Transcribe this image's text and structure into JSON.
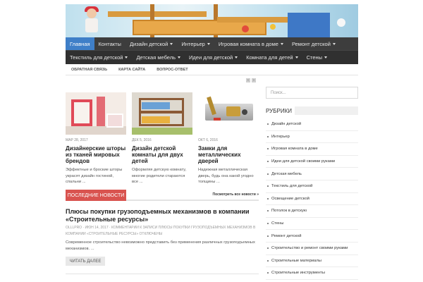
{
  "nav_primary": [
    {
      "label": "Главная",
      "dropdown": false,
      "active": true
    },
    {
      "label": "Контакты",
      "dropdown": false,
      "active": false
    },
    {
      "label": "Дизайн детской",
      "dropdown": true,
      "active": false
    },
    {
      "label": "Интерьер",
      "dropdown": true,
      "active": false
    },
    {
      "label": "Игровая комната в доме",
      "dropdown": true,
      "active": false
    },
    {
      "label": "Ремонт детской",
      "dropdown": true,
      "active": false
    }
  ],
  "nav_secondary": [
    {
      "label": "Текстиль для детской",
      "dropdown": true
    },
    {
      "label": "Детская мебель",
      "dropdown": true
    },
    {
      "label": "Идеи для детской",
      "dropdown": true
    },
    {
      "label": "Комната для детей",
      "dropdown": true
    },
    {
      "label": "Стены",
      "dropdown": true
    }
  ],
  "subnav": [
    "ОБРАТНАЯ СВЯЗЬ",
    "КАРТА САЙТА",
    "ВОПРОС-ОТВЕТ"
  ],
  "featured": [
    {
      "date": "МАР 28, 2017",
      "title": "Дизайнерские шторы из тканей мировых брендов",
      "excerpt": "Эффектные и броские шторы украсят дизайн гостиной, спальни ..."
    },
    {
      "date": "ДЕК 5, 2016",
      "title": "Дизайн детской комнаты для двух детей",
      "excerpt": "Оформляя детскую комнату, многие родители стараются все ..."
    },
    {
      "date": "ОКТ 6, 2016",
      "title": "Замки для металлических дверей",
      "excerpt": "Надежная металлическая дверь, будь она какой угодно толщины ..."
    }
  ],
  "latest": {
    "tab_label": "ПОСЛЕДНИЕ НОВОСТИ",
    "all_link": "Посмотреть все новости »"
  },
  "post": {
    "title": "Плюсы покупки грузоподъемных механизмов в компании «Строительные ресурсы»",
    "meta": "OLLLPRO · ИЮН 14, 2017 · КОММЕНТАРИИ К ЗАПИСИ ПЛЮСЫ ПОКУПКИ ГРУЗОПОДЪЕМНЫХ МЕХАНИЗМОВ В КОМПАНИИ «СТРОИТЕЛЬНЫЕ РЕСУРСЫ» ОТКЛЮЧЕНЫ",
    "text": "Современное строительство невозможно представить без применения различных грузоподъемных механизмов. ...",
    "more_label": "ЧИТАТЬ ДАЛЕЕ"
  },
  "sidebar": {
    "search_placeholder": "Поиск...",
    "rubrics_title": "РУБРИКИ",
    "categories": [
      "Дизайн детской",
      "Интерьер",
      "Игровая комната в доме",
      "Идеи для детской своими руками",
      "Детская мебель",
      "Текстиль для детской",
      "Освещение детской",
      "Потолок в детскую",
      "Стены",
      "Ремонт детской",
      "Строительство и ремонт своими руками",
      "Строительные материалы",
      "Строительные инструменты"
    ]
  },
  "colors": {
    "nav_bg": "#3d3d3d",
    "nav_active": "#3f7fc8",
    "accent_red": "#d9534f"
  }
}
